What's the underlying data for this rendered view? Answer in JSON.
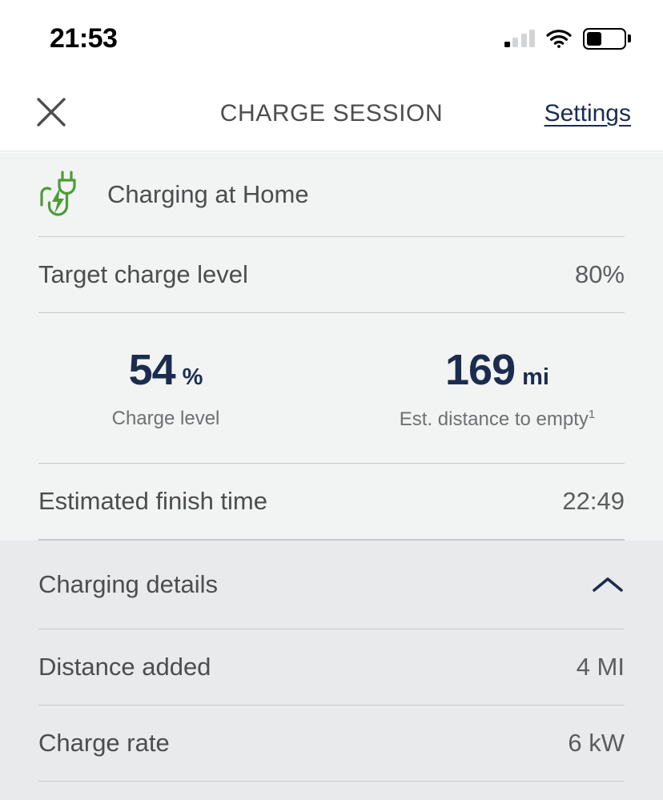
{
  "status_bar": {
    "time": "21:53",
    "signal_icon": "cellular-signal-icon",
    "signal_bars_total": 4,
    "signal_bars_active": 1,
    "wifi_icon": "wifi-icon",
    "battery_icon": "battery-icon",
    "battery_level_percent": 40
  },
  "header": {
    "close_icon": "close-icon",
    "title": "CHARGE SESSION",
    "action_label": "Settings"
  },
  "charging_status": {
    "icon": "charging-plug-icon",
    "label": "Charging at Home",
    "icon_color": "#4c9c38"
  },
  "target": {
    "label": "Target charge level",
    "value": "80%"
  },
  "stats": [
    {
      "name": "charge-level",
      "number": "54",
      "unit": "%",
      "caption": "Charge level",
      "footnote": ""
    },
    {
      "name": "est-distance-to-empty",
      "number": "169",
      "unit": "mi",
      "caption": "Est. distance to empty",
      "footnote": "1"
    }
  ],
  "finish_time": {
    "label": "Estimated finish time",
    "value": "22:49"
  },
  "charging_details": {
    "title": "Charging details",
    "chevron_icon": "chevron-up-icon",
    "expanded": true,
    "rows": [
      {
        "label": "Distance added",
        "value": "4 MI"
      },
      {
        "label": "Charge rate",
        "value": "6 kW"
      }
    ]
  },
  "colors": {
    "accent_navy": "#1b2d4f",
    "green": "#4c9c38",
    "text_gray": "#4d4d4f",
    "bg_light": "#f2f3f3",
    "bg_dark": "#e8eaec"
  }
}
